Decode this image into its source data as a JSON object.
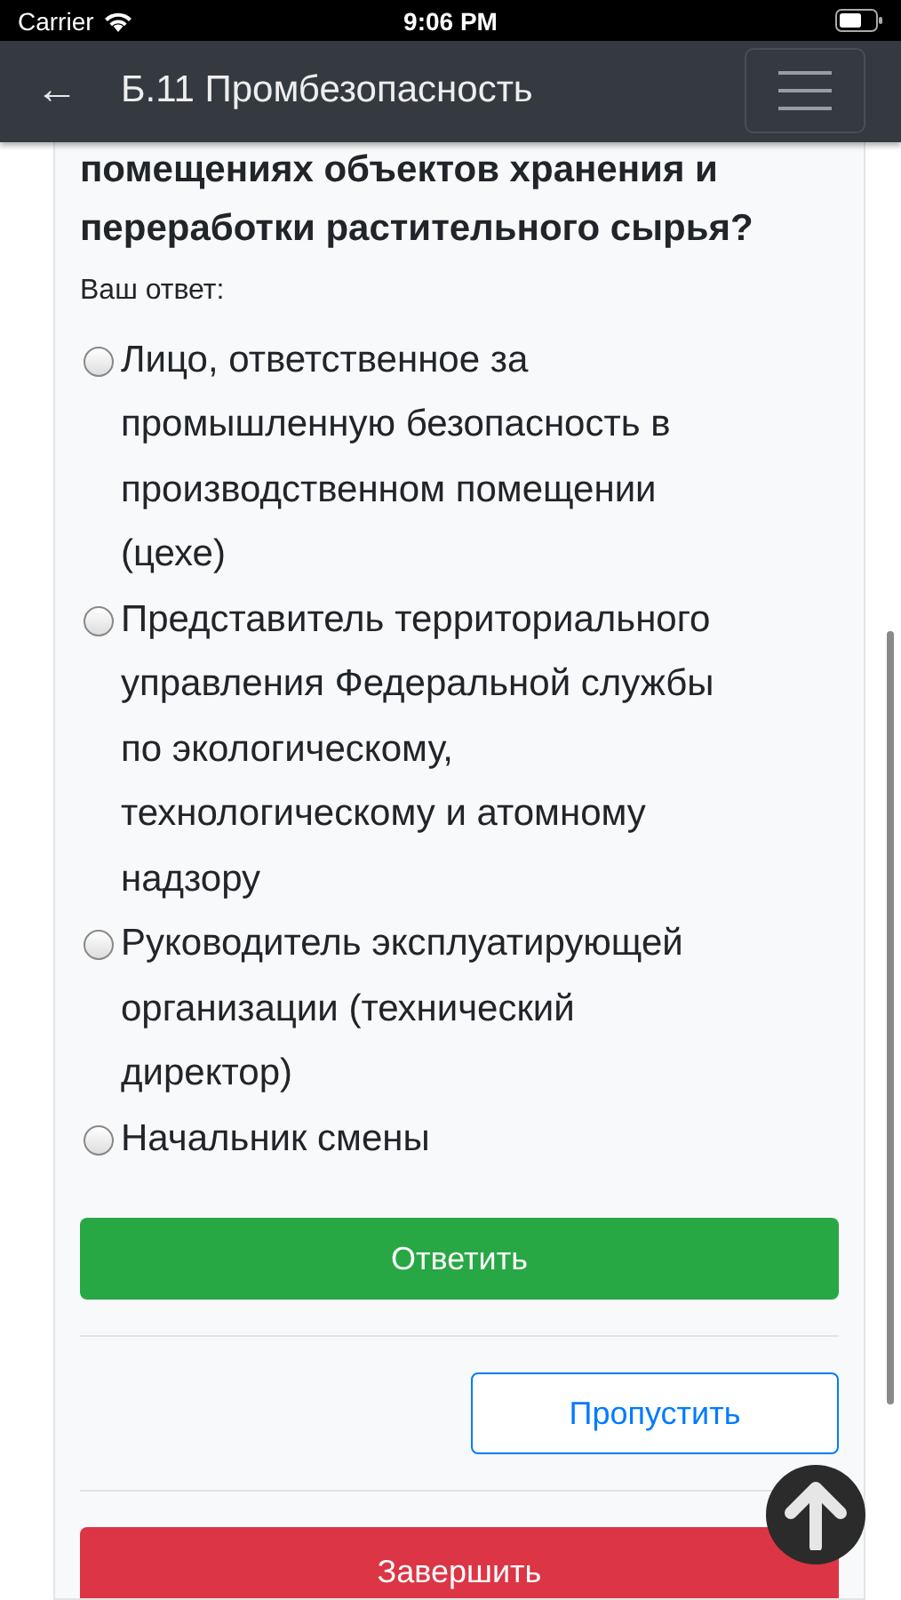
{
  "status_bar": {
    "carrier": "Carrier",
    "time": "9:06 PM"
  },
  "header": {
    "back": "←",
    "title": "Б.11 Промбезопасность"
  },
  "question": {
    "lines": [
      "помещениях объектов хранения и",
      "переработки растительного сырья?"
    ]
  },
  "answer_label": "Ваш ответ:",
  "options": [
    {
      "label": "Лицо, ответственное за промышленную безопасность в производственном помещении (цехе)",
      "selected": false
    },
    {
      "label": "Представитель территориального управления Федеральной службы по экологическому, технологическому и атомному надзору",
      "selected": false
    },
    {
      "label": "Руководитель эксплуатирующей организации (технический директор)",
      "selected": false
    },
    {
      "label": "Начальник смены",
      "selected": false
    }
  ],
  "buttons": [
    {
      "kind": "primary",
      "label": "Ответить"
    },
    {
      "kind": "outline",
      "label": "Пропустить"
    },
    {
      "kind": "danger",
      "label": "Завершить"
    }
  ]
}
